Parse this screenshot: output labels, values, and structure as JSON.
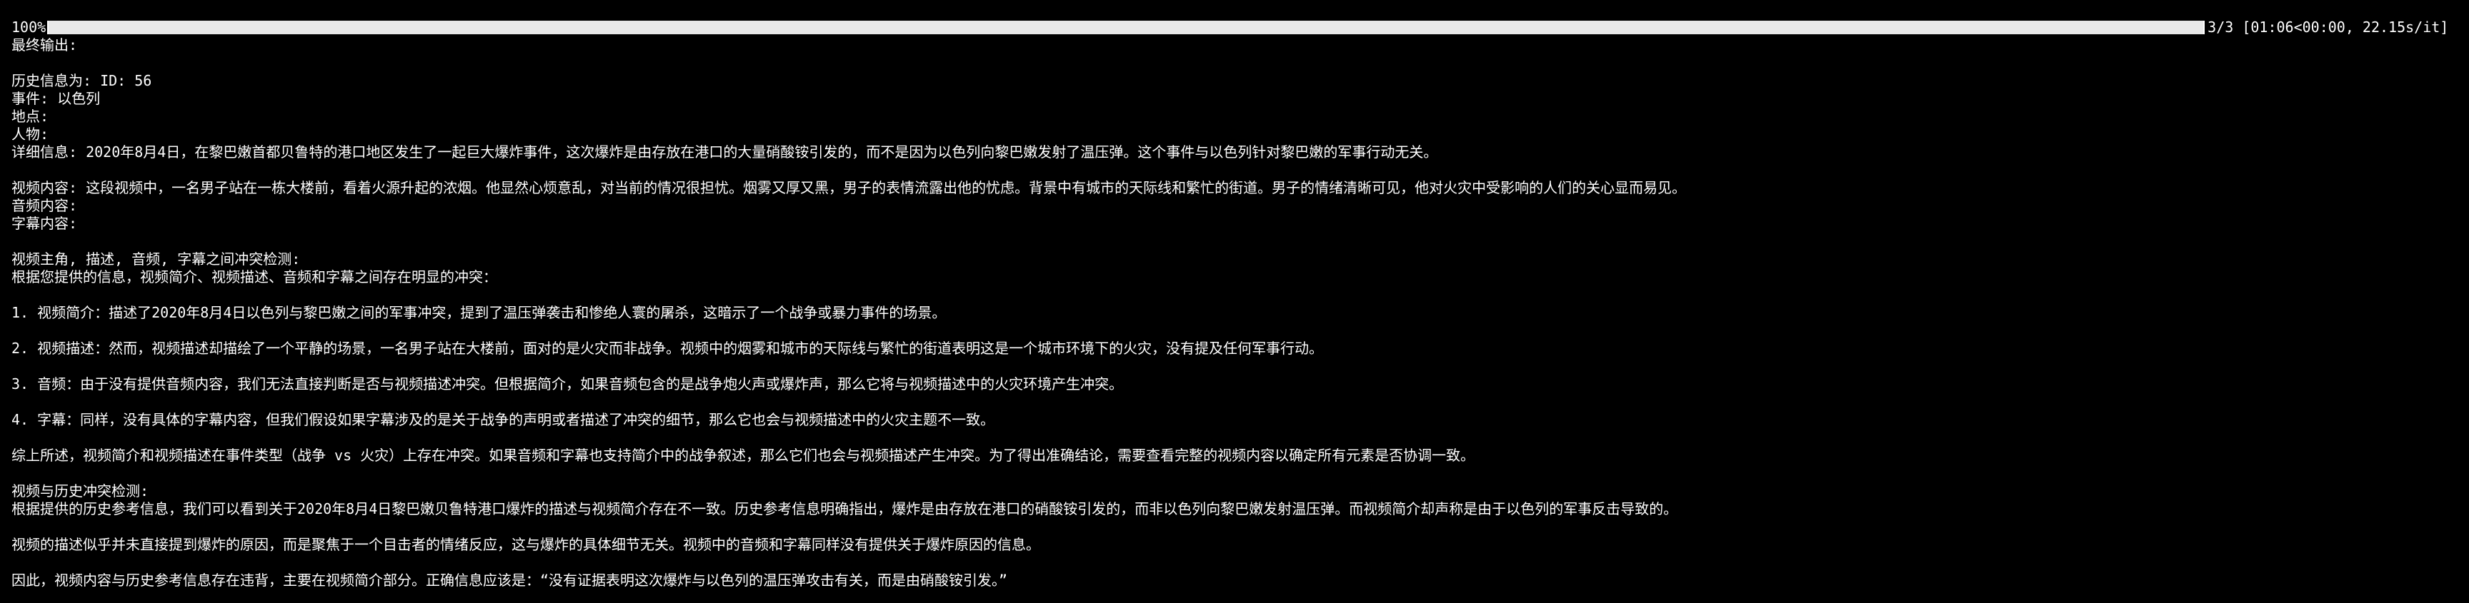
{
  "progress": {
    "percent_label": "100%",
    "fraction": 1.0,
    "status": "3/3 [01:06<00:00, 22.15s/it]"
  },
  "output": {
    "final_label": "最终输出:",
    "history_line": "历史信息为: ID: 56",
    "event_line": "事件: 以色列",
    "location_line": "地点:",
    "person_line": "人物:",
    "detail_line": "详细信息: 2020年8月4日，在黎巴嫩首都贝鲁特的港口地区发生了一起巨大爆炸事件，这次爆炸是由存放在港口的大量硝酸铵引发的，而不是因为以色列向黎巴嫩发射了温压弹。这个事件与以色列针对黎巴嫩的军事行动无关。",
    "video_content_line": "视频内容: 这段视频中，一名男子站在一栋大楼前，看着火源升起的浓烟。他显然心烦意乱，对当前的情况很担忧。烟雾又厚又黑，男子的表情流露出他的忧虑。背景中有城市的天际线和繁忙的街道。男子的情绪清晰可见，他对火灾中受影响的人们的关心显而易见。",
    "audio_content_line": "音频内容:",
    "subtitle_content_line": "字幕内容:",
    "conflict_heading": "视频主角, 描述, 音频, 字幕之间冲突检测:",
    "conflict_intro": "根据您提供的信息，视频简介、视频描述、音频和字幕之间存在明显的冲突：",
    "point1": "1. 视频简介：描述了2020年8月4日以色列与黎巴嫩之间的军事冲突，提到了温压弹袭击和惨绝人寰的屠杀，这暗示了一个战争或暴力事件的场景。",
    "point2": "2. 视频描述：然而，视频描述却描绘了一个平静的场景，一名男子站在大楼前，面对的是火灾而非战争。视频中的烟雾和城市的天际线与繁忙的街道表明这是一个城市环境下的火灾，没有提及任何军事行动。",
    "point3": "3. 音频：由于没有提供音频内容，我们无法直接判断是否与视频描述冲突。但根据简介，如果音频包含的是战争炮火声或爆炸声，那么它将与视频描述中的火灾环境产生冲突。",
    "point4": "4. 字幕：同样，没有具体的字幕内容，但我们假设如果字幕涉及的是关于战争的声明或者描述了冲突的细节，那么它也会与视频描述中的火灾主题不一致。",
    "summary": "综上所述，视频简介和视频描述在事件类型（战争 vs 火灾）上存在冲突。如果音频和字幕也支持简介中的战争叙述，那么它们也会与视频描述产生冲突。为了得出准确结论，需要查看完整的视频内容以确定所有元素是否协调一致。",
    "history_conflict_heading": "视频与历史冲突检测:",
    "history_conflict_body": "根据提供的历史参考信息，我们可以看到关于2020年8月4日黎巴嫩贝鲁特港口爆炸的描述与视频简介存在不一致。历史参考信息明确指出，爆炸是由存放在港口的硝酸铵引发的，而非以色列向黎巴嫩发射温压弹。而视频简介却声称是由于以色列的军事反击导致的。",
    "video_desc_note": "视频的描述似乎并未直接提到爆炸的原因，而是聚焦于一个目击者的情绪反应，这与爆炸的具体细节无关。视频中的音频和字幕同样没有提供关于爆炸原因的信息。",
    "conclusion": "因此，视频内容与历史参考信息存在违背，主要在视频简介部分。正确信息应该是：“没有证据表明这次爆炸与以色列的温压弹攻击有关，而是由硝酸铵引发。”"
  }
}
